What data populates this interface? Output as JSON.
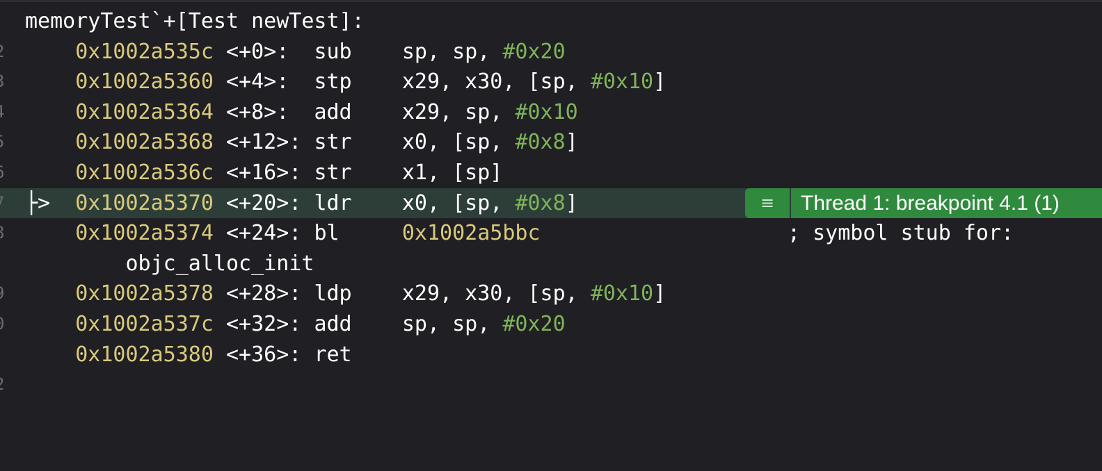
{
  "function_header": "memoryTest`+[Test newTest]:",
  "gutter_numbers": [
    "2",
    "3",
    "4",
    "5",
    "6",
    "7",
    "8",
    "",
    "9",
    "0",
    "",
    "2"
  ],
  "instructions": [
    {
      "addr": "0x1002a535c",
      "offset": "<+0>:  ",
      "mnemonic": "sub    ",
      "op_pre": "sp, sp, ",
      "op_imm": "#0x20",
      "op_post": ""
    },
    {
      "addr": "0x1002a5360",
      "offset": "<+4>:  ",
      "mnemonic": "stp    ",
      "op_pre": "x29, x30, [sp, ",
      "op_imm": "#0x10",
      "op_post": "]"
    },
    {
      "addr": "0x1002a5364",
      "offset": "<+8>:  ",
      "mnemonic": "add    ",
      "op_pre": "x29, sp, ",
      "op_imm": "#0x10",
      "op_post": ""
    },
    {
      "addr": "0x1002a5368",
      "offset": "<+12>: ",
      "mnemonic": "str    ",
      "op_pre": "x0, [sp, ",
      "op_imm": "#0x8",
      "op_post": "]"
    },
    {
      "addr": "0x1002a536c",
      "offset": "<+16>: ",
      "mnemonic": "str    ",
      "op_pre": "x1, [sp]",
      "op_imm": "",
      "op_post": ""
    },
    {
      "addr": "0x1002a5370",
      "offset": "<+20>: ",
      "mnemonic": "ldr    ",
      "op_pre": "x0, [sp, ",
      "op_imm": "#0x8",
      "op_post": "]"
    },
    {
      "addr": "0x1002a5374",
      "offset": "<+24>: ",
      "mnemonic": "bl     ",
      "branch_target": "0x1002a5bbc",
      "comment": "; symbol stub for:",
      "comment_cont": "objc_alloc_init"
    },
    {
      "addr": "0x1002a5378",
      "offset": "<+28>: ",
      "mnemonic": "ldp    ",
      "op_pre": "x29, x30, [sp, ",
      "op_imm": "#0x10",
      "op_post": "]"
    },
    {
      "addr": "0x1002a537c",
      "offset": "<+32>: ",
      "mnemonic": "add    ",
      "op_pre": "sp, sp, ",
      "op_imm": "#0x20",
      "op_post": ""
    },
    {
      "addr": "0x1002a5380",
      "offset": "<+36>: ",
      "mnemonic": "ret",
      "op_pre": "",
      "op_imm": "",
      "op_post": ""
    }
  ],
  "pc_marker": "├>",
  "breakpoint": {
    "icon": "≡",
    "label": "Thread 1: breakpoint 4.1 (1)"
  },
  "colors": {
    "address": "#d9c97c",
    "immediate": "#7fb35a",
    "background": "#1f1f24",
    "pc_highlight": "#2d3e38",
    "breakpoint_badge": "#2f8a3e"
  },
  "icons": {
    "breakpoint_icon": "lines-icon"
  }
}
